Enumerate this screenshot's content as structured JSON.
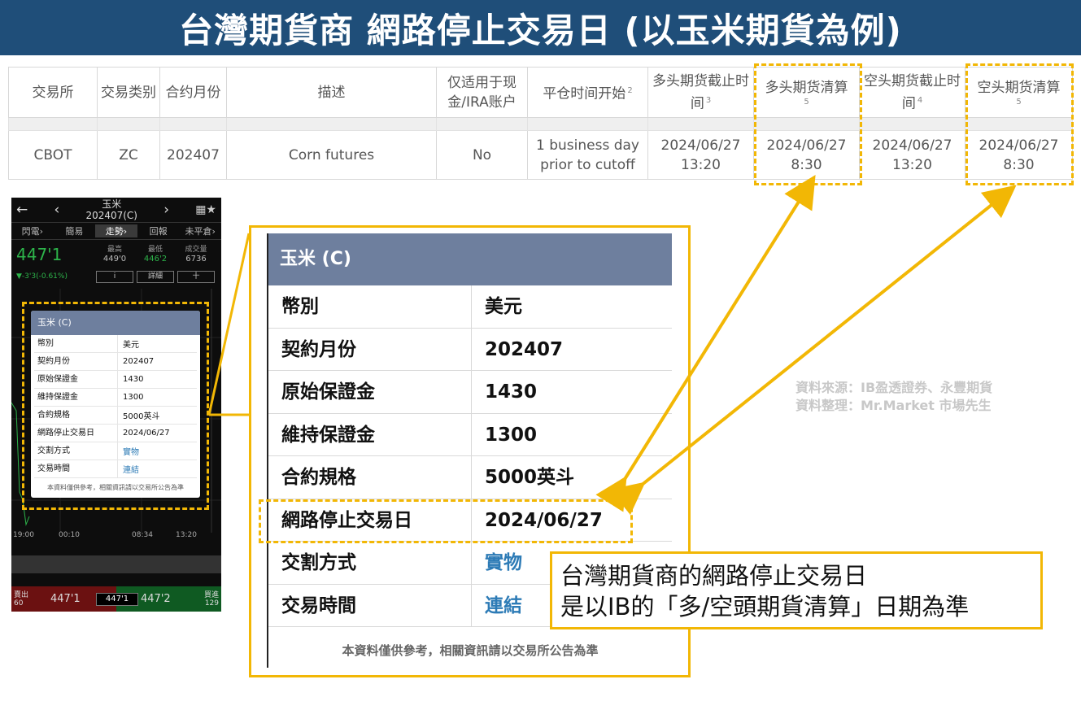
{
  "banner": {
    "title": "台灣期貨商 網路停止交易日 (以玉米期貨為例)"
  },
  "ib_table": {
    "headers": [
      {
        "text": "交易所"
      },
      {
        "text": "交易类别"
      },
      {
        "text": "合约月份"
      },
      {
        "text": "描述"
      },
      {
        "text": "仅适用于现金/IRA账户"
      },
      {
        "text": "平仓时间开始",
        "note": "2"
      },
      {
        "text": "多头期货截止时间",
        "note": "3"
      },
      {
        "text": "多头期货清算",
        "note": "5"
      },
      {
        "text": "空头期货截止时间",
        "note": "4"
      },
      {
        "text": "空头期货清算",
        "note": "5"
      }
    ],
    "row": [
      "CBOT",
      "ZC",
      "202407",
      "Corn futures",
      "No",
      "1 business day prior to cutoff",
      "2024/06/27 13:20",
      "2024/06/27 8:30",
      "2024/06/27 13:20",
      "2024/06/27 8:30"
    ]
  },
  "phone": {
    "title": "玉米",
    "contract": "202407(C)",
    "tabs": [
      "閃電›",
      "簡易",
      "走勢›",
      "回報",
      "未平倉›"
    ],
    "price": "447'1",
    "change": "▼-3'3(-0.61%)",
    "stats": [
      {
        "label": "最高",
        "value": "449'0"
      },
      {
        "label": "最低",
        "value": "446'2"
      },
      {
        "label": "成交量",
        "value": "6736"
      }
    ],
    "buttons": [
      "i",
      "詳細",
      "十"
    ],
    "time_axis": [
      "19:00",
      "00:10",
      "08:34",
      "13:20"
    ],
    "sell_label": "賣出",
    "sell_qty": "60",
    "sell_price": "447'1",
    "mid_price": "447'1",
    "buy_label": "買進",
    "buy_qty": "129",
    "buy_price": "447'2"
  },
  "contract_info": {
    "title": "玉米 (C)",
    "rows": [
      {
        "key": "幣別",
        "value": "美元"
      },
      {
        "key": "契約月份",
        "value": "202407"
      },
      {
        "key": "原始保證金",
        "value": "1430"
      },
      {
        "key": "維持保證金",
        "value": "1300"
      },
      {
        "key": "合約規格",
        "value": "5000英斗"
      },
      {
        "key": "網路停止交易日",
        "value": "2024/06/27"
      },
      {
        "key": "交割方式",
        "value": "實物"
      },
      {
        "key": "交易時間",
        "value": "連結"
      }
    ],
    "footer": "本資料僅供參考，相關資訊請以交易所公告為準"
  },
  "annotation": {
    "line1": "台灣期貨商的網路停止交易日",
    "line2": "是以IB的「多/空頭期貨清算」日期為準"
  },
  "source": {
    "line1": "資料來源：IB盈透證券、永豐期貨",
    "line2": "資料整理：Mr.Market 市場先生"
  },
  "colors": {
    "banner": "#1f4e79",
    "highlight": "#f2b705",
    "card_header": "#6e7f9e",
    "link": "#2d7bb6",
    "green": "#2db34a"
  }
}
